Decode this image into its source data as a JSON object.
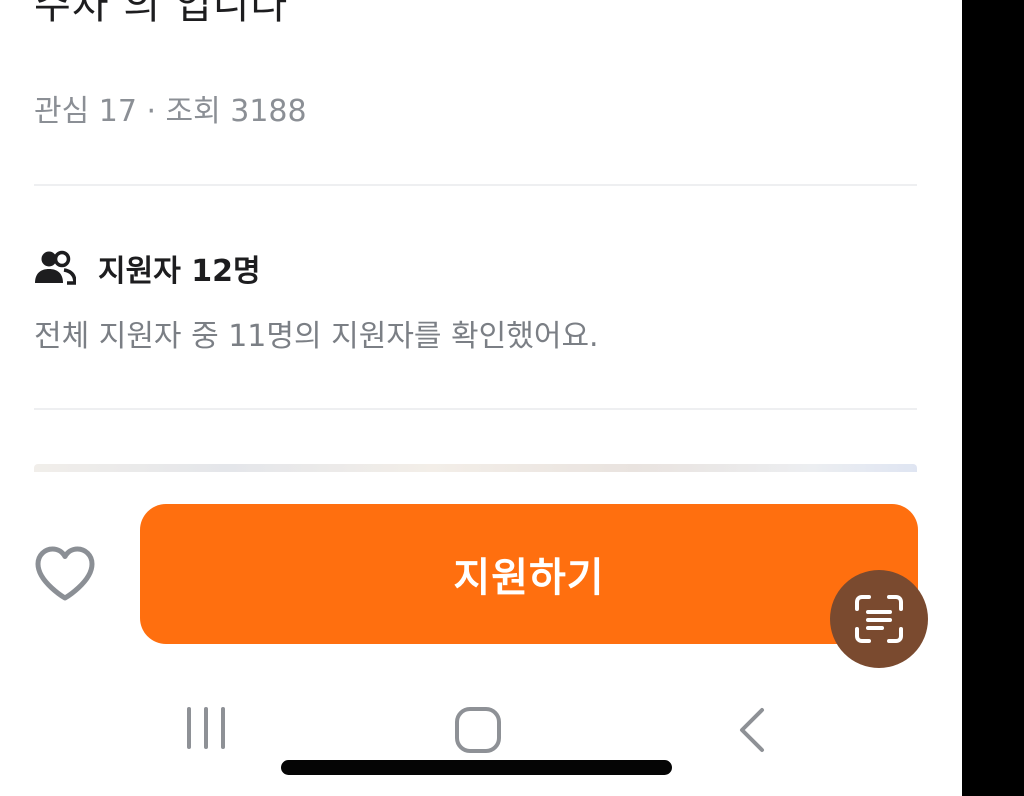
{
  "listing": {
    "title_partial": "주차  의  입니다",
    "meta": "관심 17 · 조회 3188"
  },
  "applicants": {
    "icon": "people-icon",
    "title": "지원자 12명",
    "description": "전체 지원자 중 11명의 지원자를 확인했어요."
  },
  "action_bar": {
    "favorite_icon": "heart-outline-icon",
    "apply_label": "지원하기"
  },
  "overlay": {
    "scan_icon": "text-scan-icon"
  },
  "nav": {
    "recents_icon": "recent-apps-icon",
    "home_icon": "home-icon",
    "back_icon": "back-icon"
  },
  "colors": {
    "accent": "#ff6f0f",
    "scan_fab": "#7a4a2f",
    "text_primary": "#1d1d1f",
    "text_secondary": "#7b7f85",
    "divider": "#eeeff1"
  }
}
